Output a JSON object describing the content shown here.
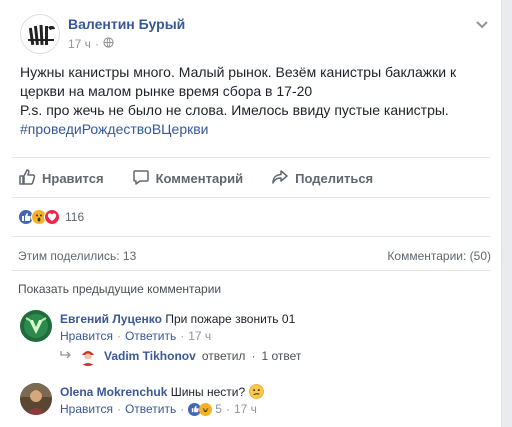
{
  "post": {
    "author": "Валентин Бурый",
    "time": "17 ч",
    "separator": "·",
    "text_line1": "Нужны канистры много. Малый рынок. Везём канистры баклажки к",
    "text_line2": "церкви на малом рынке время сбора в 17-20",
    "text_line3": "P.s. про жечь не было не слова. Имелось ввиду пустые канистры.",
    "hashtag": "#проведиРождествоВЦеркви"
  },
  "actions": {
    "like": "Нравится",
    "comment": "Комментарий",
    "share": "Поделиться"
  },
  "reactions": {
    "count": "116",
    "types": [
      "like-icon",
      "wow-icon",
      "love-icon"
    ],
    "colors": {
      "like": "#4267b2",
      "wow": "#f7b125",
      "love": "#f0284a"
    }
  },
  "stats": {
    "shares": "Этим поделились: 13",
    "comments": "Комментарии: (50)"
  },
  "show_previous": "Показать предыдущие комментарии",
  "comments": [
    {
      "name": "Евгений Луценко",
      "text": "При пожаре звонить 01",
      "like": "Нравится",
      "reply": "Ответить",
      "time": "17 ч",
      "reply_summary": {
        "name": "Vadim Tikhonov",
        "action": "ответил",
        "count": "1 ответ"
      }
    },
    {
      "name": "Olena Mokrenchuk",
      "text": "Шины нести?",
      "like": "Нравится",
      "reply": "Ответить",
      "reaction_count": "5",
      "time": "17 ч"
    }
  ],
  "dot": "·"
}
